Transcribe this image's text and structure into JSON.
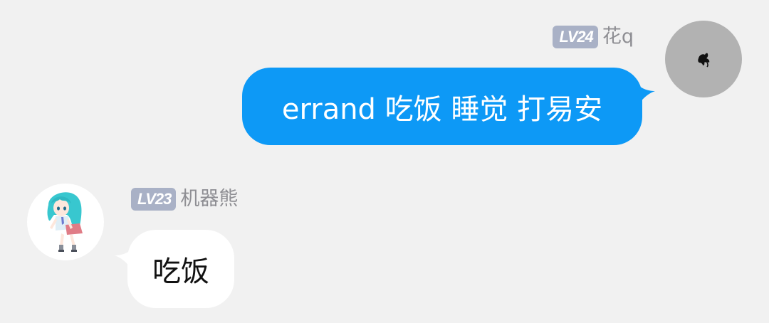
{
  "messages": [
    {
      "direction": "outgoing",
      "sender": {
        "level": "LV24",
        "name": "花q",
        "avatar_icon": "bird-silhouette-icon",
        "avatar_bg": "#b2b2b2"
      },
      "text": "errand 吃饭 睡觉 打易安",
      "bubble_color": "#0d99f6"
    },
    {
      "direction": "incoming",
      "sender": {
        "level": "LV23",
        "name": "机器熊",
        "avatar_icon": "anime-girl-avatar-icon",
        "avatar_bg": "#ffffff"
      },
      "text": "吃饭",
      "bubble_color": "#ffffff"
    }
  ],
  "colors": {
    "background": "#f1f1f1",
    "level_badge": "#a9b1c6",
    "nickname": "#8e8e93"
  }
}
